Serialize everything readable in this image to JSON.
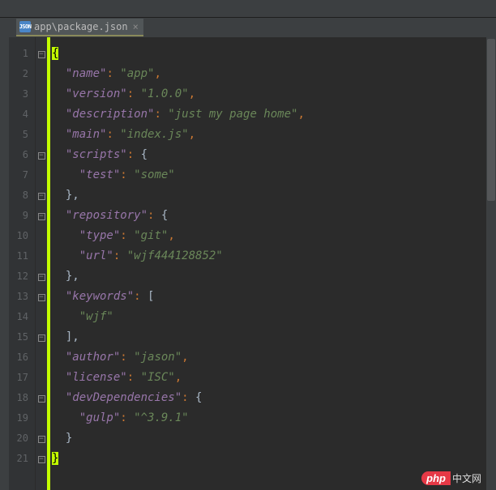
{
  "tab": {
    "icon_label": "JSON",
    "filename": "app\\package.json",
    "close_glyph": "×"
  },
  "gutter": {
    "lines": [
      "1",
      "2",
      "3",
      "4",
      "5",
      "6",
      "7",
      "8",
      "9",
      "10",
      "11",
      "12",
      "13",
      "14",
      "15",
      "16",
      "17",
      "18",
      "19",
      "20",
      "21",
      ""
    ]
  },
  "fold": {
    "marks": [
      "open",
      "",
      "",
      "",
      "",
      "open",
      "",
      "close",
      "open",
      "",
      "",
      "close",
      "open",
      "",
      "close",
      "",
      "",
      "open",
      "",
      "close",
      "close",
      ""
    ]
  },
  "code": {
    "l1_open": "{",
    "l2_k": "\"name\"",
    "l2_c": ": ",
    "l2_v": "\"app\"",
    "l2_e": ",",
    "l3_k": "\"version\"",
    "l3_c": ": ",
    "l3_v": "\"1.0.0\"",
    "l3_e": ",",
    "l4_k": "\"description\"",
    "l4_c": ": ",
    "l4_v": "\"just my page home\"",
    "l4_e": ",",
    "l5_k": "\"main\"",
    "l5_c": ": ",
    "l5_v": "\"index.js\"",
    "l5_e": ",",
    "l6_k": "\"scripts\"",
    "l6_c": ": ",
    "l6_v": "{",
    "l7_k": "\"test\"",
    "l7_c": ": ",
    "l7_v": "\"some\"",
    "l8": "},",
    "l9_k": "\"repository\"",
    "l9_c": ": ",
    "l9_v": "{",
    "l10_k": "\"type\"",
    "l10_c": ": ",
    "l10_v": "\"git\"",
    "l10_e": ",",
    "l11_k": "\"url\"",
    "l11_c": ": ",
    "l11_v": "\"wjf444128852\"",
    "l12": "},",
    "l13_k": "\"keywords\"",
    "l13_c": ": ",
    "l13_v": "[",
    "l14_v": "\"wjf\"",
    "l15": "],",
    "l16_k": "\"author\"",
    "l16_c": ": ",
    "l16_v": "\"jason\"",
    "l16_e": ",",
    "l17_k": "\"license\"",
    "l17_c": ": ",
    "l17_v": "\"ISC\"",
    "l17_e": ",",
    "l18_k": "\"devDependencies\"",
    "l18_c": ": ",
    "l18_v": "{",
    "l19_k": "\"gulp\"",
    "l19_c": ": ",
    "l19_v": "\"^3.9.1\"",
    "l20": "}",
    "l21_close": "}"
  },
  "watermark": {
    "php": "php",
    "cn": "中文网"
  }
}
